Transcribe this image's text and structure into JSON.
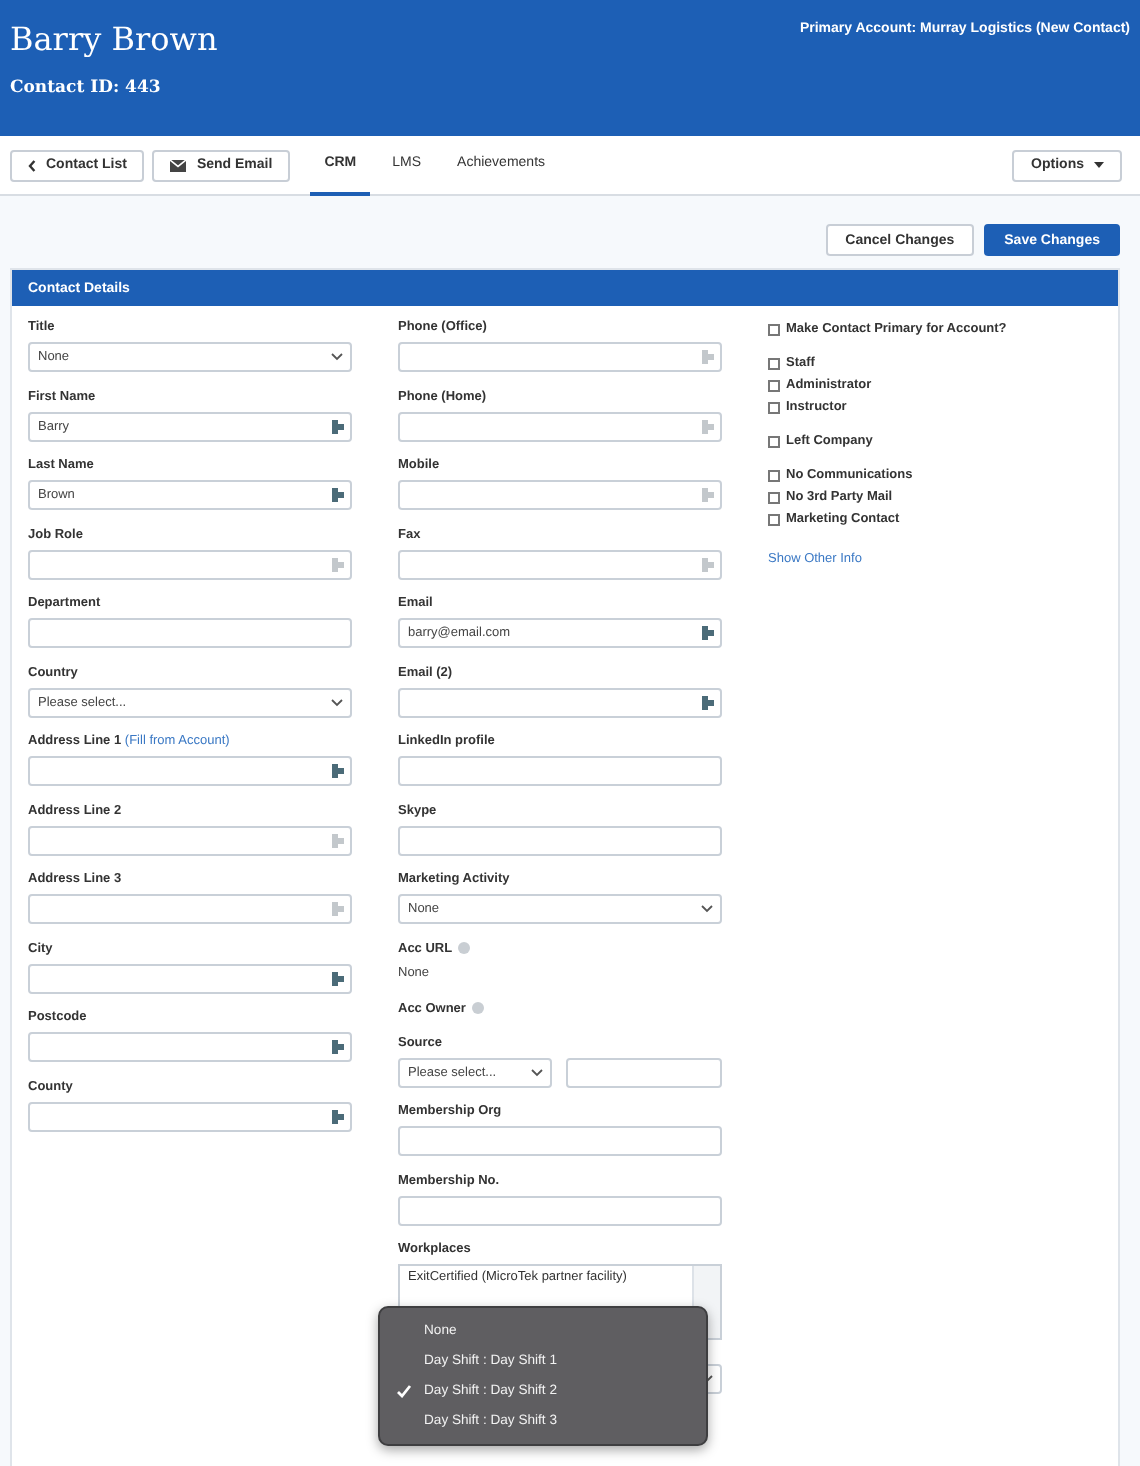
{
  "header": {
    "name": "Barry Brown",
    "contact_id": "Contact ID: 443",
    "primary_account": "Primary Account: Murray Logistics (New Contact)"
  },
  "toolbar": {
    "buttons": [
      {
        "label": "Contact List",
        "kind": "back"
      },
      {
        "label": "Send Email",
        "kind": "mail"
      }
    ],
    "tabs": [
      {
        "label": "CRM",
        "selected": true
      },
      {
        "label": "LMS",
        "selected": false
      },
      {
        "label": "Achievements",
        "selected": false
      }
    ],
    "options": "Options"
  },
  "actions": [
    {
      "label": "Cancel Changes",
      "primary": false
    },
    {
      "label": "Save Changes",
      "primary": true
    }
  ],
  "panel": {
    "title": "Contact Details",
    "column_1": [
      {
        "kind": "select",
        "label": "Title",
        "value": "None"
      },
      {
        "kind": "text",
        "label": "First Name",
        "value": "Barry",
        "lookup": true
      },
      {
        "kind": "text",
        "label": "Last Name",
        "value": "Brown",
        "lookup": true
      },
      {
        "kind": "text",
        "label": "Job Role",
        "lookup": false
      },
      {
        "kind": "text",
        "label": "Department"
      },
      {
        "kind": "select",
        "label": "Country",
        "value": "Please select..."
      },
      {
        "kind": "text",
        "label": "Address Line 1",
        "link": "(Fill from Account)",
        "lookup": true
      },
      {
        "kind": "text",
        "label": "Address Line 2",
        "lookup": false
      },
      {
        "kind": "text",
        "label": "Address Line 3",
        "lookup": false
      },
      {
        "kind": "text",
        "label": "City",
        "lookup": true
      },
      {
        "kind": "text",
        "label": "Postcode",
        "lookup": true
      },
      {
        "kind": "text",
        "label": "County",
        "lookup": true
      }
    ],
    "column_2": [
      {
        "kind": "text",
        "label": "Phone (Office)",
        "lookup": false
      },
      {
        "kind": "text",
        "label": "Phone (Home)",
        "lookup": false
      },
      {
        "kind": "text",
        "label": "Mobile",
        "lookup": false
      },
      {
        "kind": "text",
        "label": "Fax",
        "lookup": false
      },
      {
        "kind": "text",
        "label": "Email",
        "value": "barry@email.com",
        "lookup": true
      },
      {
        "kind": "text",
        "label": "Email (2)",
        "lookup": true
      },
      {
        "kind": "text",
        "label": "LinkedIn profile"
      },
      {
        "kind": "text",
        "label": "Skype"
      },
      {
        "kind": "select",
        "label": "Marketing Activity",
        "value": "None"
      },
      {
        "kind": "info",
        "label": "Acc URL",
        "value": "None"
      },
      {
        "kind": "info",
        "label": "Acc Owner"
      },
      {
        "kind": "select_text",
        "label": "Source",
        "value": "Please select..."
      },
      {
        "kind": "text",
        "label": "Membership Org"
      },
      {
        "kind": "text",
        "label": "Membership No."
      },
      {
        "kind": "listbox",
        "label": "Workplaces",
        "items": [
          "ExitCertified (MicroTek partner facility)"
        ]
      },
      {
        "kind": "select"
      }
    ],
    "column_3": {
      "groups": [
        [
          {
            "label": "Make Contact Primary for Account?",
            "checked": false
          }
        ],
        [
          {
            "label": "Staff",
            "checked": false
          },
          {
            "label": "Administrator",
            "checked": false
          },
          {
            "label": "Instructor",
            "checked": false
          }
        ],
        [
          {
            "label": "Left Company",
            "checked": false
          }
        ],
        [
          {
            "label": "No Communications",
            "checked": false
          },
          {
            "label": "No 3rd Party Mail",
            "checked": false
          },
          {
            "label": "Marketing Contact",
            "checked": false
          }
        ]
      ],
      "link": "Show Other Info"
    }
  },
  "dropdown": {
    "options": [
      {
        "label": "None",
        "selected": false
      },
      {
        "label": "Day Shift : Day Shift 1",
        "selected": false
      },
      {
        "label": "Day Shift : Day Shift 2",
        "selected": true
      },
      {
        "label": "Day Shift : Day Shift 3",
        "selected": false
      }
    ]
  }
}
